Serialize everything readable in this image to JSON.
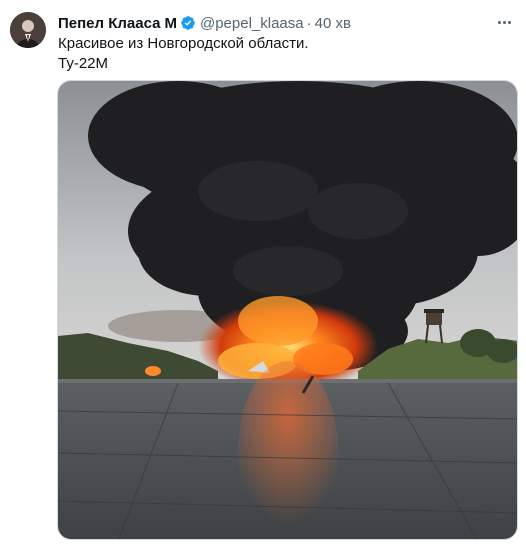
{
  "author": {
    "display_name": "Пепел Клааса",
    "emoji_badge": "M",
    "handle": "@pepel_klaasa",
    "separator": "·",
    "time": "40 хв",
    "verified_color": "#1d9bf0"
  },
  "tweet": {
    "line1": "Красивое из Новгородской области.",
    "line2": "Ту-22M"
  },
  "icons": {
    "verified": "verified-badge-icon",
    "more": "more-options-icon"
  },
  "colors": {
    "text": "#0f1419",
    "secondary": "#536471",
    "smoke": "#1e1e20",
    "fire": "#ff6a1a"
  }
}
